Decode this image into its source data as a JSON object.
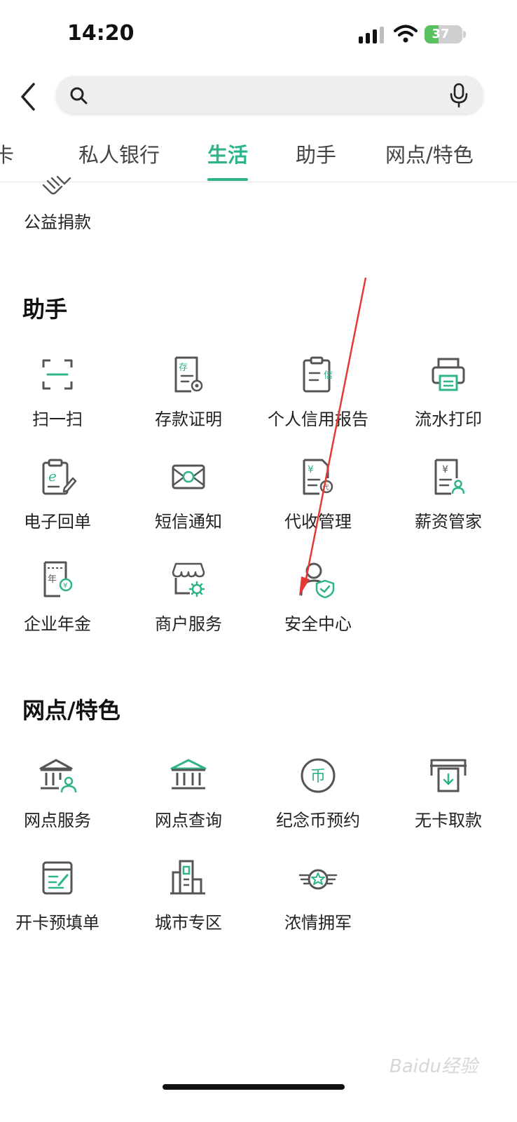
{
  "status_bar": {
    "time": "14:20",
    "battery": "37",
    "battery_level": 0.37
  },
  "search": {
    "placeholder": ""
  },
  "tabs": [
    {
      "label": "用卡"
    },
    {
      "label": "私人银行"
    },
    {
      "label": "生活",
      "active": true
    },
    {
      "label": "助手"
    },
    {
      "label": "网点/特色"
    }
  ],
  "top_partial": {
    "label": "公益捐款",
    "icon": "handshake-icon"
  },
  "sections": {
    "assistant": {
      "title": "助手",
      "items": [
        {
          "label": "扫一扫",
          "icon": "scan-icon"
        },
        {
          "label": "存款证明",
          "icon": "deposit-certificate-icon"
        },
        {
          "label": "个人信用报告",
          "icon": "credit-report-icon"
        },
        {
          "label": "流水打印",
          "icon": "printer-icon"
        },
        {
          "label": "电子回单",
          "icon": "e-receipt-icon"
        },
        {
          "label": "短信通知",
          "icon": "sms-envelope-icon"
        },
        {
          "label": "代收管理",
          "icon": "collection-management-icon"
        },
        {
          "label": "薪资管家",
          "icon": "salary-manager-icon"
        },
        {
          "label": "企业年金",
          "icon": "annuity-icon"
        },
        {
          "label": "商户服务",
          "icon": "merchant-store-icon"
        },
        {
          "label": "安全中心",
          "icon": "security-user-shield-icon"
        }
      ]
    },
    "outlets": {
      "title": "网点/特色",
      "items": [
        {
          "label": "网点服务",
          "icon": "bank-user-icon"
        },
        {
          "label": "网点查询",
          "icon": "bank-building-icon"
        },
        {
          "label": "纪念币预约",
          "icon": "coin-icon"
        },
        {
          "label": "无卡取款",
          "icon": "cardless-atm-icon"
        },
        {
          "label": "开卡预填单",
          "icon": "form-fill-icon"
        },
        {
          "label": "城市专区",
          "icon": "city-buildings-icon"
        },
        {
          "label": "浓情拥军",
          "icon": "military-star-badge-icon"
        }
      ]
    }
  },
  "watermark": "Baidu经验",
  "colors": {
    "accent": "#2fb38a",
    "icon_stroke": "#555555",
    "annotation": "#e53935"
  }
}
